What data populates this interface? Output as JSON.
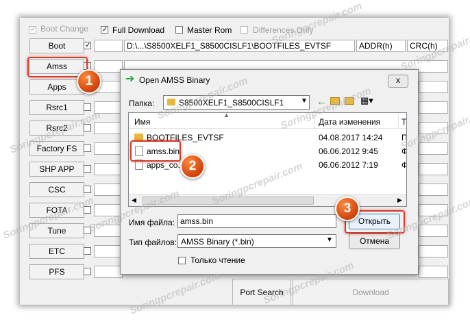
{
  "options": {
    "boot_change": "Boot Change",
    "full_download": "Full Download",
    "master_rom": "Master Rom",
    "differences_only": "Differences Only"
  },
  "columns": {
    "addr": "ADDR(h)",
    "crc": "CRC(h)"
  },
  "boot_path": "D:\\...\\S8500XELF1_S8500CISLF1\\BOOTFILES_EVTSF",
  "side_buttons": [
    "Boot",
    "Amss",
    "Apps",
    "Rsrc1",
    "Rsrc2",
    "Factory FS",
    "SHP APP",
    "CSC",
    "FOTA",
    "Tune",
    "ETC",
    "PFS"
  ],
  "bottom": {
    "port_search": "Port Search",
    "download": "Download"
  },
  "dialog": {
    "title": "Open AMSS Binary",
    "close": "x",
    "folder_label": "Папка:",
    "folder_value": "S8500XELF1_S8500CISLF1",
    "col_name": "Имя",
    "col_date": "Дата изменения",
    "col_type": "Т",
    "files": [
      {
        "name": "BOOTFILES_EVTSF",
        "date": "04.08.2017 14:24",
        "type": "П"
      },
      {
        "name": "amss.bin",
        "date": "06.06.2012 9:45",
        "type": "Ф"
      },
      {
        "name": "apps_co...d.bin",
        "date": "06.06.2012 7:19",
        "type": "Ф"
      }
    ],
    "filename_label": "Имя файла:",
    "filename_value": "amss.bin",
    "filetype_label": "Тип файлов:",
    "filetype_value": "AMSS Binary (*.bin)",
    "readonly_label": "Только чтение",
    "open_button": "Открыть",
    "cancel_button": "Отмена"
  },
  "badges": {
    "one": "1",
    "two": "2",
    "three": "3"
  },
  "watermark": "Soringpcrepair.com",
  "colors": {
    "highlight": "#d23a2a",
    "badge": "#e2581a",
    "folder": "#e8b93c"
  }
}
